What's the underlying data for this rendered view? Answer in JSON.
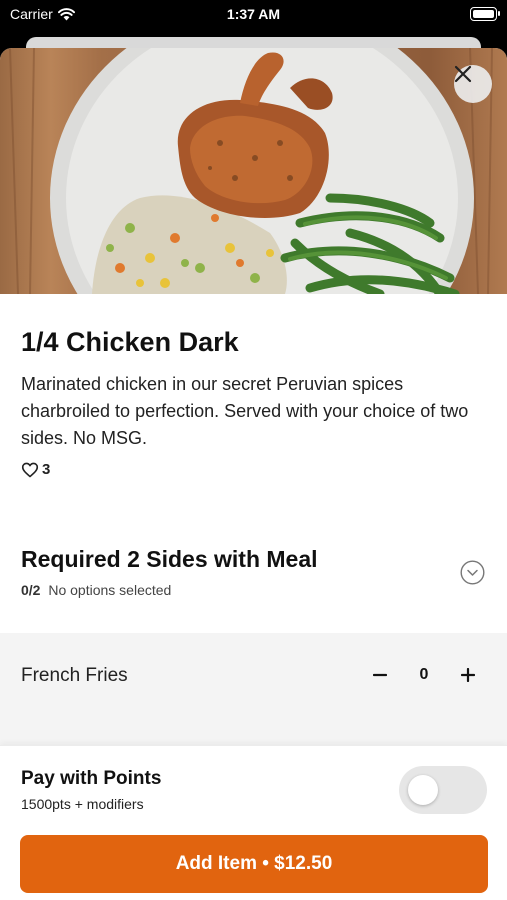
{
  "status_bar": {
    "carrier": "Carrier",
    "time": "1:37 AM"
  },
  "item": {
    "title": "1/4 Chicken Dark",
    "description": "Marinated chicken in our secret Peruvian spices charbroiled to perfection. Served with your choice of two sides. No MSG.",
    "likes": "3"
  },
  "modifier_group": {
    "title": "Required 2 Sides with Meal",
    "count": "0/2",
    "status": "No options selected",
    "options": [
      {
        "label": "French Fries",
        "quantity": "0"
      }
    ]
  },
  "footer": {
    "points_title": "Pay with Points",
    "points_sub": "1500pts + modifiers",
    "points_toggle_on": false,
    "add_button": "Add Item • $12.50",
    "accent_color": "#e1640f"
  },
  "icons": {
    "close": "close-icon",
    "heart": "heart-icon",
    "chevron": "chevron-down-icon",
    "minus": "minus-icon",
    "plus": "plus-icon"
  }
}
